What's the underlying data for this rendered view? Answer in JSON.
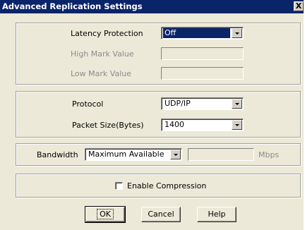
{
  "window": {
    "title": "Advanced Replication Settings",
    "close_glyph": "X"
  },
  "latency": {
    "protection_label": "Latency Protection",
    "protection_value": "Off",
    "high_mark_label": "High Mark Value",
    "high_mark_value": "",
    "low_mark_label": "Low Mark Value",
    "low_mark_value": ""
  },
  "transport": {
    "protocol_label": "Protocol",
    "protocol_value": "UDP/IP",
    "packet_size_label": "Packet Size(Bytes)",
    "packet_size_value": "1400"
  },
  "bandwidth": {
    "label": "Bandwidth",
    "mode_value": "Maximum Available",
    "amount_value": "",
    "unit": "Mbps"
  },
  "compression": {
    "label": "Enable Compression",
    "checked": false
  },
  "buttons": {
    "ok": "OK",
    "cancel": "Cancel",
    "help": "Help"
  }
}
